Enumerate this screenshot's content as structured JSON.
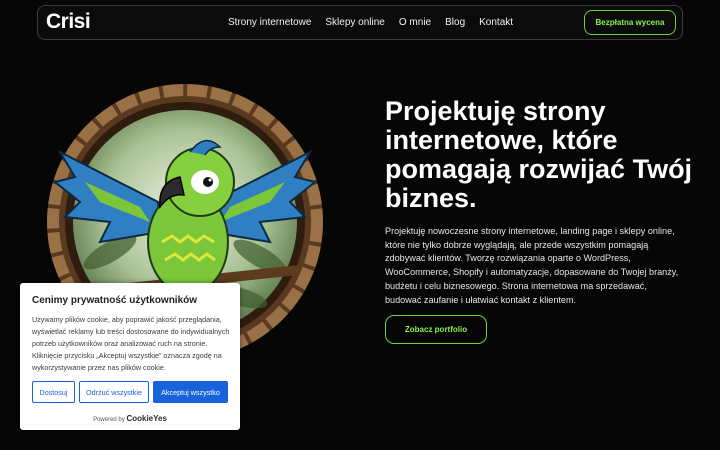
{
  "nav": {
    "logo": "Crisi",
    "items": [
      "Strony internetowe",
      "Sklepy online",
      "O mnie",
      "Blog",
      "Kontakt"
    ],
    "cta": "Bezpłatna wycena"
  },
  "hero": {
    "title": "Projektuję strony internetowe, które pomagają rozwijać Twój biznes.",
    "text": "Projektuję nowoczesne strony internetowe, landing page i sklepy online, które nie tylko dobrze wyglądają, ale przede wszystkim pomagają zdobywać klientów. Tworzę rozwiązania oparte o WordPress, WooCommerce, Shopify i automatyzacje, dopasowane do Twojej branży, budżetu i celu biznesowego. Strona internetowa ma sprzedawać, budować zaufanie i ułatwiać kontakt z klientem.",
    "cta": "Zobacz portfolio"
  },
  "cookie": {
    "title": "Cenimy prywatność użytkowników",
    "text": "Używamy plików cookie, aby poprawić jakość przeglądania, wyświetlać reklamy lub treści dostosowane do indywidualnych potrzeb użytkowników oraz analizować ruch na stronie. Kliknięcie przycisku „Akceptuj wszystkie” oznacza zgodę na wykorzystywanie przez nas plików cookie.",
    "customize": "Dostosuj",
    "reject": "Odrzuć wszystkie",
    "accept": "Akceptuj wszystko",
    "powered_by": "Powered by",
    "brand": "CookieYes"
  },
  "colors": {
    "accent_green": "#8cef4f",
    "cookie_blue": "#1863dc",
    "background": "#060606"
  },
  "illustration": "parrot-in-round-wooden-frame"
}
